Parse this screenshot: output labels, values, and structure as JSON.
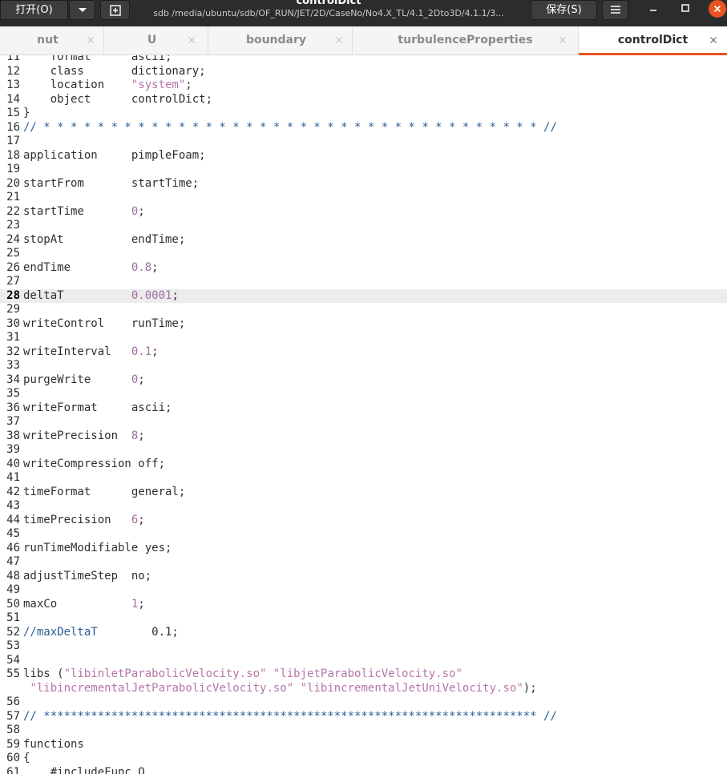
{
  "header": {
    "open_label": "打开(O)",
    "title": "controlDict",
    "subtitle": "sdb /media/ubuntu/sdb/OF_RUN/JET/2D/CaseNo/No4.X_TL/4.1_2Dto3D/4.1.1/3...",
    "save_label": "保存(S)"
  },
  "tabs": [
    {
      "label": "nut",
      "active": false
    },
    {
      "label": "U",
      "active": false
    },
    {
      "label": "boundary",
      "active": false
    },
    {
      "label": "turbulenceProperties",
      "active": false
    },
    {
      "label": "controlDict",
      "active": true
    }
  ],
  "editor": {
    "current_line": 28,
    "lines": [
      {
        "n": "11",
        "t": [
          [
            "k",
            "    format      ascii;"
          ]
        ]
      },
      {
        "n": "12",
        "t": [
          [
            "k",
            "    class       dictionary;"
          ]
        ]
      },
      {
        "n": "13",
        "t": [
          [
            "k",
            "    location    "
          ],
          [
            "s",
            "\"system\""
          ],
          [
            "k",
            ";"
          ]
        ]
      },
      {
        "n": "14",
        "t": [
          [
            "k",
            "    object      controlDict;"
          ]
        ]
      },
      {
        "n": "15",
        "t": [
          [
            "k",
            "}"
          ]
        ]
      },
      {
        "n": "16",
        "t": [
          [
            "c",
            "// * * * * * * * * * * * * * * * * * * * * * * * * * * * * * * * * * * * * * //"
          ]
        ]
      },
      {
        "n": "17",
        "t": []
      },
      {
        "n": "18",
        "t": [
          [
            "k",
            "application     pimpleFoam;"
          ]
        ]
      },
      {
        "n": "19",
        "t": []
      },
      {
        "n": "20",
        "t": [
          [
            "k",
            "startFrom       startTime;"
          ]
        ]
      },
      {
        "n": "21",
        "t": []
      },
      {
        "n": "22",
        "t": [
          [
            "k",
            "startTime       "
          ],
          [
            "n",
            "0"
          ],
          [
            "k",
            ";"
          ]
        ]
      },
      {
        "n": "23",
        "t": []
      },
      {
        "n": "24",
        "t": [
          [
            "k",
            "stopAt          endTime;"
          ]
        ]
      },
      {
        "n": "25",
        "t": []
      },
      {
        "n": "26",
        "t": [
          [
            "k",
            "endTime         "
          ],
          [
            "n",
            "0.8"
          ],
          [
            "k",
            ";"
          ]
        ]
      },
      {
        "n": "27",
        "t": []
      },
      {
        "n": "28",
        "t": [
          [
            "k",
            "deltaT          "
          ],
          [
            "n",
            "0.0001"
          ],
          [
            "k",
            ";"
          ]
        ]
      },
      {
        "n": "29",
        "t": []
      },
      {
        "n": "30",
        "t": [
          [
            "k",
            "writeControl    runTime;"
          ]
        ]
      },
      {
        "n": "31",
        "t": []
      },
      {
        "n": "32",
        "t": [
          [
            "k",
            "writeInterval   "
          ],
          [
            "n",
            "0.1"
          ],
          [
            "k",
            ";"
          ]
        ]
      },
      {
        "n": "33",
        "t": []
      },
      {
        "n": "34",
        "t": [
          [
            "k",
            "purgeWrite      "
          ],
          [
            "n",
            "0"
          ],
          [
            "k",
            ";"
          ]
        ]
      },
      {
        "n": "35",
        "t": []
      },
      {
        "n": "36",
        "t": [
          [
            "k",
            "writeFormat     ascii;"
          ]
        ]
      },
      {
        "n": "37",
        "t": []
      },
      {
        "n": "38",
        "t": [
          [
            "k",
            "writePrecision  "
          ],
          [
            "n",
            "8"
          ],
          [
            "k",
            ";"
          ]
        ]
      },
      {
        "n": "39",
        "t": []
      },
      {
        "n": "40",
        "t": [
          [
            "k",
            "writeCompression off;"
          ]
        ]
      },
      {
        "n": "41",
        "t": []
      },
      {
        "n": "42",
        "t": [
          [
            "k",
            "timeFormat      general;"
          ]
        ]
      },
      {
        "n": "43",
        "t": []
      },
      {
        "n": "44",
        "t": [
          [
            "k",
            "timePrecision   "
          ],
          [
            "n",
            "6"
          ],
          [
            "k",
            ";"
          ]
        ]
      },
      {
        "n": "45",
        "t": []
      },
      {
        "n": "46",
        "t": [
          [
            "k",
            "runTimeModifiable yes;"
          ]
        ]
      },
      {
        "n": "47",
        "t": []
      },
      {
        "n": "48",
        "t": [
          [
            "k",
            "adjustTimeStep  no;"
          ]
        ]
      },
      {
        "n": "49",
        "t": []
      },
      {
        "n": "50",
        "t": [
          [
            "k",
            "maxCo           "
          ],
          [
            "n",
            "1"
          ],
          [
            "k",
            ";"
          ]
        ]
      },
      {
        "n": "51",
        "t": []
      },
      {
        "n": "52",
        "t": [
          [
            "c",
            "//maxDeltaT"
          ],
          [
            "k",
            "        0.1;"
          ]
        ]
      },
      {
        "n": "53",
        "t": []
      },
      {
        "n": "54",
        "t": []
      },
      {
        "n": "55",
        "t": [
          [
            "k",
            "libs ("
          ],
          [
            "s",
            "\"libinletParabolicVelocity.so\""
          ],
          [
            "k",
            " "
          ],
          [
            "s",
            "\"libjetParabolicVelocity.so\""
          ]
        ]
      },
      {
        "n": "",
        "t": [
          [
            "k",
            " "
          ],
          [
            "s",
            "\"libincrementalJetParabolicVelocity.so\""
          ],
          [
            "k",
            " "
          ],
          [
            "s",
            "\"libincrementalJetUniVelocity.so\""
          ],
          [
            "k",
            ");"
          ]
        ]
      },
      {
        "n": "56",
        "t": []
      },
      {
        "n": "57",
        "t": [
          [
            "c",
            "// ************************************************************************* //"
          ]
        ]
      },
      {
        "n": "58",
        "t": []
      },
      {
        "n": "59",
        "t": [
          [
            "k",
            "functions"
          ]
        ]
      },
      {
        "n": "60",
        "t": [
          [
            "k",
            "{"
          ]
        ]
      },
      {
        "n": "61",
        "t": [
          [
            "k",
            "    #includeFunc Q"
          ]
        ]
      }
    ]
  },
  "colors": {
    "headerbar": "#2c2c2c",
    "accent": "#e95420",
    "number": "#a36fa0",
    "string": "#b775a6",
    "comment": "#2a5c96",
    "current_line": "#ececec"
  }
}
